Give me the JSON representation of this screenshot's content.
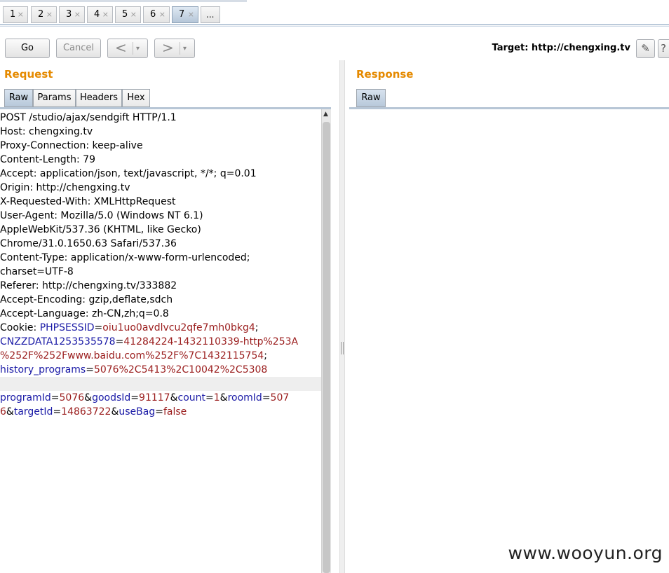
{
  "tabs": [
    {
      "label": "1",
      "close": "×"
    },
    {
      "label": "2",
      "close": "×"
    },
    {
      "label": "3",
      "close": "×"
    },
    {
      "label": "4",
      "close": "×"
    },
    {
      "label": "5",
      "close": "×"
    },
    {
      "label": "6",
      "close": "×"
    },
    {
      "label": "7",
      "close": "×"
    },
    {
      "label": "..."
    }
  ],
  "toolbar": {
    "go_label": "Go",
    "cancel_label": "Cancel",
    "back_glyph": "<",
    "forward_glyph": ">",
    "dropdown_glyph": "▾",
    "target_label": "Target: http://chengxing.tv",
    "edit_icon": "✎",
    "help_icon": "?"
  },
  "request": {
    "title": "Request",
    "tabs": [
      "Raw",
      "Params",
      "Headers",
      "Hex"
    ],
    "lines": [
      [
        {
          "t": "POST /studio/ajax/sendgift HTTP/1.1"
        }
      ],
      [
        {
          "t": "Host: chengxing.tv"
        }
      ],
      [
        {
          "t": "Proxy-Connection: keep-alive"
        }
      ],
      [
        {
          "t": "Content-Length: 79"
        }
      ],
      [
        {
          "t": "Accept: application/json, text/javascript, */*; q=0.01"
        }
      ],
      [
        {
          "t": "Origin: http://chengxing.tv"
        }
      ],
      [
        {
          "t": "X-Requested-With: XMLHttpRequest"
        }
      ],
      [
        {
          "t": "User-Agent: Mozilla/5.0 (Windows NT 6.1)"
        }
      ],
      [
        {
          "t": "AppleWebKit/537.36 (KHTML, like Gecko)"
        }
      ],
      [
        {
          "t": "Chrome/31.0.1650.63 Safari/537.36"
        }
      ],
      [
        {
          "t": "Content-Type: application/x-www-form-urlencoded;"
        }
      ],
      [
        {
          "t": "charset=UTF-8"
        }
      ],
      [
        {
          "t": "Referer: http://chengxing.tv/333882"
        }
      ],
      [
        {
          "t": "Accept-Encoding: gzip,deflate,sdch"
        }
      ],
      [
        {
          "t": "Accept-Language: zh-CN,zh;q=0.8"
        }
      ],
      [
        {
          "t": "Cookie: "
        },
        {
          "t": "PHPSESSID",
          "c": "k"
        },
        {
          "t": "="
        },
        {
          "t": "oiu1uo0avdlvcu2qfe7mh0bkg4",
          "c": "v"
        },
        {
          "t": ";"
        }
      ],
      [
        {
          "t": "CNZZDATA1253535578",
          "c": "k"
        },
        {
          "t": "="
        },
        {
          "t": "41284224-1432110339-http%253A",
          "c": "v"
        }
      ],
      [
        {
          "t": "%252F%252Fwww.baidu.com%252F%7C1432115754",
          "c": "v"
        },
        {
          "t": ";"
        }
      ],
      [
        {
          "t": "history_programs",
          "c": "k"
        },
        {
          "t": "="
        },
        {
          "t": "5076%2C5413%2C10042%2C5308",
          "c": "v"
        }
      ],
      [],
      [
        {
          "t": "programId",
          "c": "k"
        },
        {
          "t": "="
        },
        {
          "t": "5076",
          "c": "v"
        },
        {
          "t": "&"
        },
        {
          "t": "goodsId",
          "c": "k"
        },
        {
          "t": "="
        },
        {
          "t": "91117",
          "c": "v"
        },
        {
          "t": "&"
        },
        {
          "t": "count",
          "c": "k"
        },
        {
          "t": "="
        },
        {
          "t": "1",
          "c": "v"
        },
        {
          "t": "&"
        },
        {
          "t": "roomId",
          "c": "k"
        },
        {
          "t": "="
        },
        {
          "t": "507",
          "c": "v"
        }
      ],
      [
        {
          "t": "6",
          "c": "v"
        },
        {
          "t": "&"
        },
        {
          "t": "targetId",
          "c": "k"
        },
        {
          "t": "="
        },
        {
          "t": "14863722",
          "c": "v"
        },
        {
          "t": "&"
        },
        {
          "t": "useBag",
          "c": "k"
        },
        {
          "t": "="
        },
        {
          "t": "false",
          "c": "v"
        }
      ]
    ],
    "highlight_line": 19
  },
  "response": {
    "title": "Response",
    "tabs": [
      "Raw"
    ]
  },
  "watermark": "www.wooyun.org",
  "colors": {
    "title_orange": "#e58a00",
    "param_name": "#1a1aa6",
    "param_value": "#9a1c1c"
  }
}
